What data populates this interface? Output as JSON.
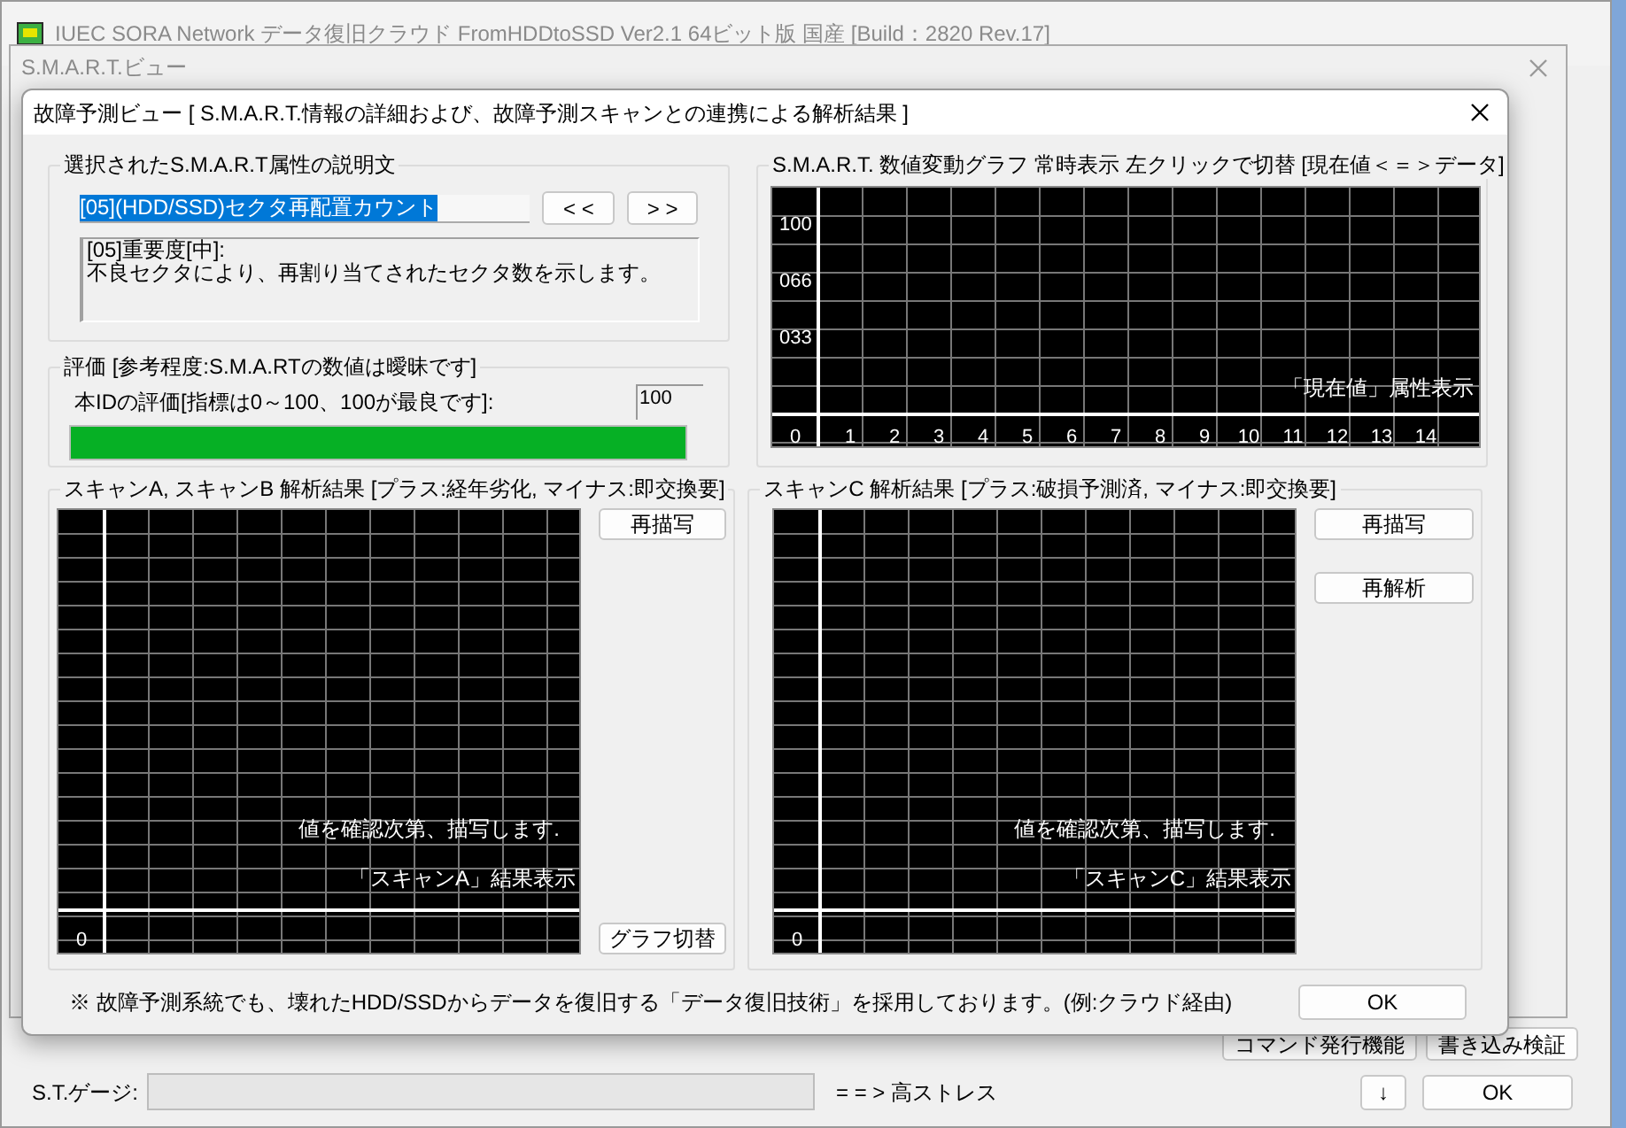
{
  "main_window": {
    "title": "IUEC SORA Network データ復旧クラウド FromHDDtoSSD Ver2.1 64ビット版 国産 [Build：2820 Rev.17]",
    "buttons": [
      "コマンド発行機能",
      "書き込み検証"
    ],
    "gauge_label": "S.T.ゲージ:",
    "gauge_note": "= = > 高ストレス",
    "down_button": "↓",
    "ok_button": "OK"
  },
  "smart_window": {
    "title": "S.M.A.R.T.ビュー"
  },
  "dialog": {
    "title": "故障予測ビュー [ S.M.A.R.T.情報の詳細および、故障予測スキャンとの連携による解析結果 ]",
    "description": {
      "title": "選択されたS.M.A.R.T属性の説明文",
      "attribute": {
        "value": "[05](HDD/SSD)セクタ再配置カウント",
        "highlighted": true
      },
      "prev_button": "< <",
      "next_button": "> >",
      "lines": [
        "[05]重要度[中]:",
        "不良セクタにより、再割り当てされたセクタ数を示します。"
      ]
    },
    "rating": {
      "title": "評価 [参考程度:S.M.A.RTの数値は曖昧です]",
      "label": "本IDの評価[指標は0～100、100が最良です]:",
      "value": "100",
      "level": 1
    },
    "trend_graph": {
      "title": "S.M.A.R.T. 数値変動グラフ 常時表示 左クリックで切替 [現在値＜＝＞データ]",
      "y_labels": [
        "100",
        "066",
        "033"
      ],
      "x_labels": [
        "0",
        "1",
        "2",
        "3",
        "4",
        "5",
        "6",
        "7",
        "8",
        "9",
        "10",
        "11",
        "12",
        "13",
        "14"
      ],
      "caption": "「現在値」属性表示"
    },
    "scans": [
      {
        "title": "スキャンA, スキャンB 解析結果 [プラス:経年劣化, マイナス:即交換要]",
        "message": "値を確認次第、描写します.",
        "caption": "「スキャンA」結果表示",
        "axis_label": "0",
        "buttons": [
          {
            "label": "再描写",
            "kind": "top"
          },
          {
            "label": "グラフ切替",
            "kind": "bottom"
          }
        ]
      },
      {
        "title": "スキャンC 解析結果 [プラス:破損予測済, マイナス:即交換要]",
        "message": "値を確認次第、描写します.",
        "caption": "「スキャンC」結果表示",
        "axis_label": "0",
        "buttons": [
          {
            "label": "再描写",
            "kind": "top"
          },
          {
            "label": "再解析",
            "kind": "top"
          }
        ]
      }
    ],
    "note": "※ 故障予測系統でも、壊れたHDD/SSDからデータを復旧する「データ復旧技術」を採用しております。(例:クラウド経由)",
    "ok_button": "OK"
  }
}
